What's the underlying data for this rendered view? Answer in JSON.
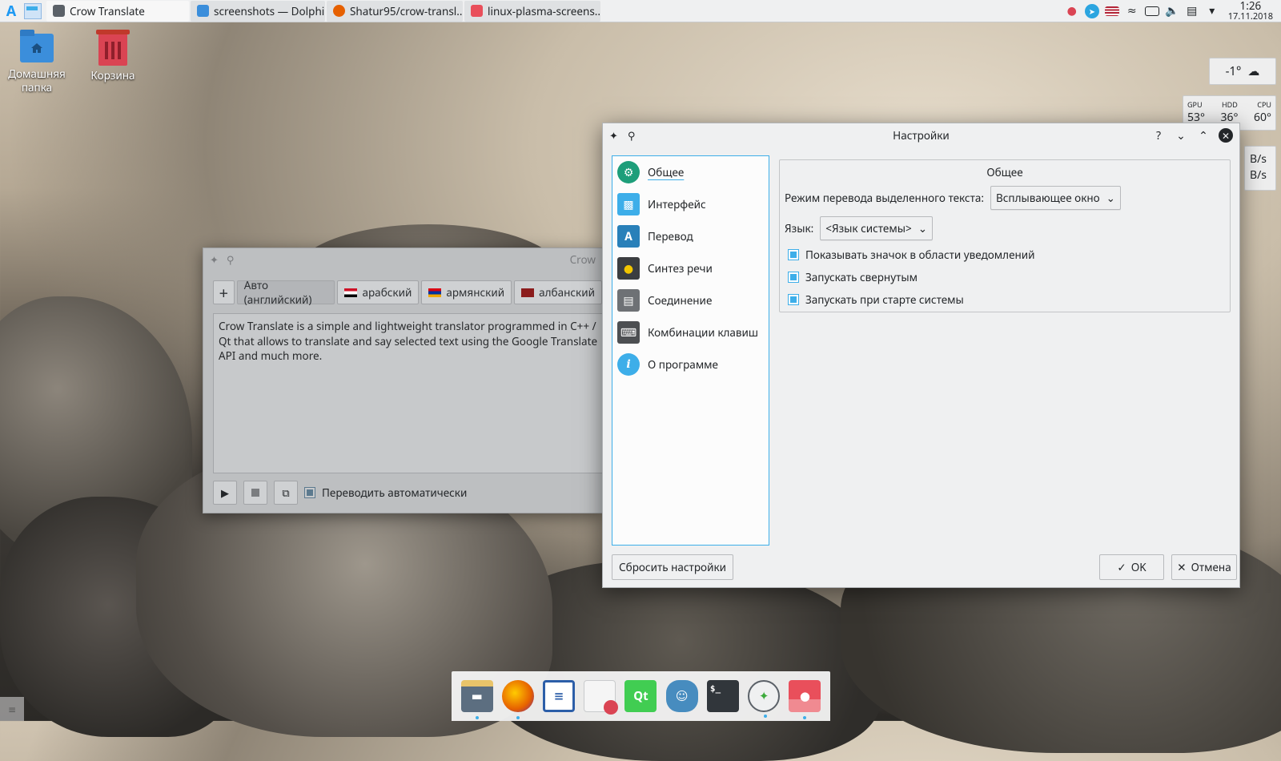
{
  "panel": {
    "tasks": [
      {
        "label": "Crow Translate",
        "color": "#5b6168"
      },
      {
        "label": "screenshots — Dolphin",
        "color": "#3b8edb"
      },
      {
        "label": "Shatur95/crow-transl...",
        "color": "#e66000"
      },
      {
        "label": "linux-plasma-screens...",
        "color": "#e94f5b"
      }
    ],
    "clock": {
      "time": "1:26",
      "date": "17.11.2018"
    }
  },
  "desktop": {
    "home_folder": "Домашняя папка",
    "trash": "Корзина"
  },
  "widgets": {
    "weather_temp": "-1°",
    "gpu_label": "GPU",
    "hdd_label": "HDD",
    "cpu_label": "CPU",
    "gpu": "53°",
    "hdd": "36°",
    "cpu": "60°",
    "net_up": "B/s",
    "net_down": "B/s"
  },
  "crow": {
    "title": "Crow",
    "add_label": "+",
    "lang_tabs": [
      {
        "label": "Авто (английский)"
      },
      {
        "label": "арабский",
        "flag": "arabic"
      },
      {
        "label": "армянский",
        "flag": "armenian"
      },
      {
        "label": "албанский",
        "flag": "albanian"
      }
    ],
    "source_text": "Crow Translate is a simple and lightweight translator programmed in C++ / Qt that allows to translate and say selected text using the Google Translate API and much more.",
    "auto_translate_label": "Переводить автоматически"
  },
  "settings": {
    "title": "Настройки",
    "help": "?",
    "nav": [
      {
        "label": "Общее",
        "icon": "gear-icon",
        "color": "#1e9e7a"
      },
      {
        "label": "Интерфейс",
        "icon": "window-icon",
        "color": "#3daee9"
      },
      {
        "label": "Перевод",
        "icon": "translate-icon",
        "color": "#2980b9"
      },
      {
        "label": "Синтез речи",
        "icon": "speaker-icon",
        "color": "#3b3d40"
      },
      {
        "label": "Соединение",
        "icon": "network-icon",
        "color": "#6e7175"
      },
      {
        "label": "Комбинации клавиш",
        "icon": "keyboard-icon",
        "color": "#4d4f52"
      },
      {
        "label": "О программе",
        "icon": "info-icon",
        "color": "#3daee9"
      }
    ],
    "group_title": "Общее",
    "mode_label": "Режим перевода выделенного текста:",
    "mode_value": "Всплывающее окно",
    "lang_label": "Язык:",
    "lang_value": "<Язык системы>",
    "checkboxes": [
      {
        "label": "Показывать значок в области уведомлений"
      },
      {
        "label": "Запускать свернутым"
      },
      {
        "label": "Запускать при старте системы"
      }
    ],
    "reset_label": "Сбросить настройки",
    "ok_label": "OK",
    "cancel_label": "Отмена"
  },
  "dock": {
    "apps": [
      {
        "icon": "file-manager-icon",
        "color": "#5c6e80"
      },
      {
        "icon": "firefox-icon",
        "color": "#e66000"
      },
      {
        "icon": "text-editor-icon",
        "color": "#2c5ea8"
      },
      {
        "icon": "document-editor-icon",
        "color": "#dfe1e3"
      },
      {
        "icon": "qt-creator-icon",
        "color": "#41cd52"
      },
      {
        "icon": "godot-icon",
        "color": "#478cbf"
      },
      {
        "icon": "terminal-icon",
        "color": "#31363b"
      },
      {
        "icon": "crow-translate-icon",
        "color": "#eff0f1"
      },
      {
        "icon": "image-viewer-icon",
        "color": "#e94f5b"
      }
    ]
  }
}
